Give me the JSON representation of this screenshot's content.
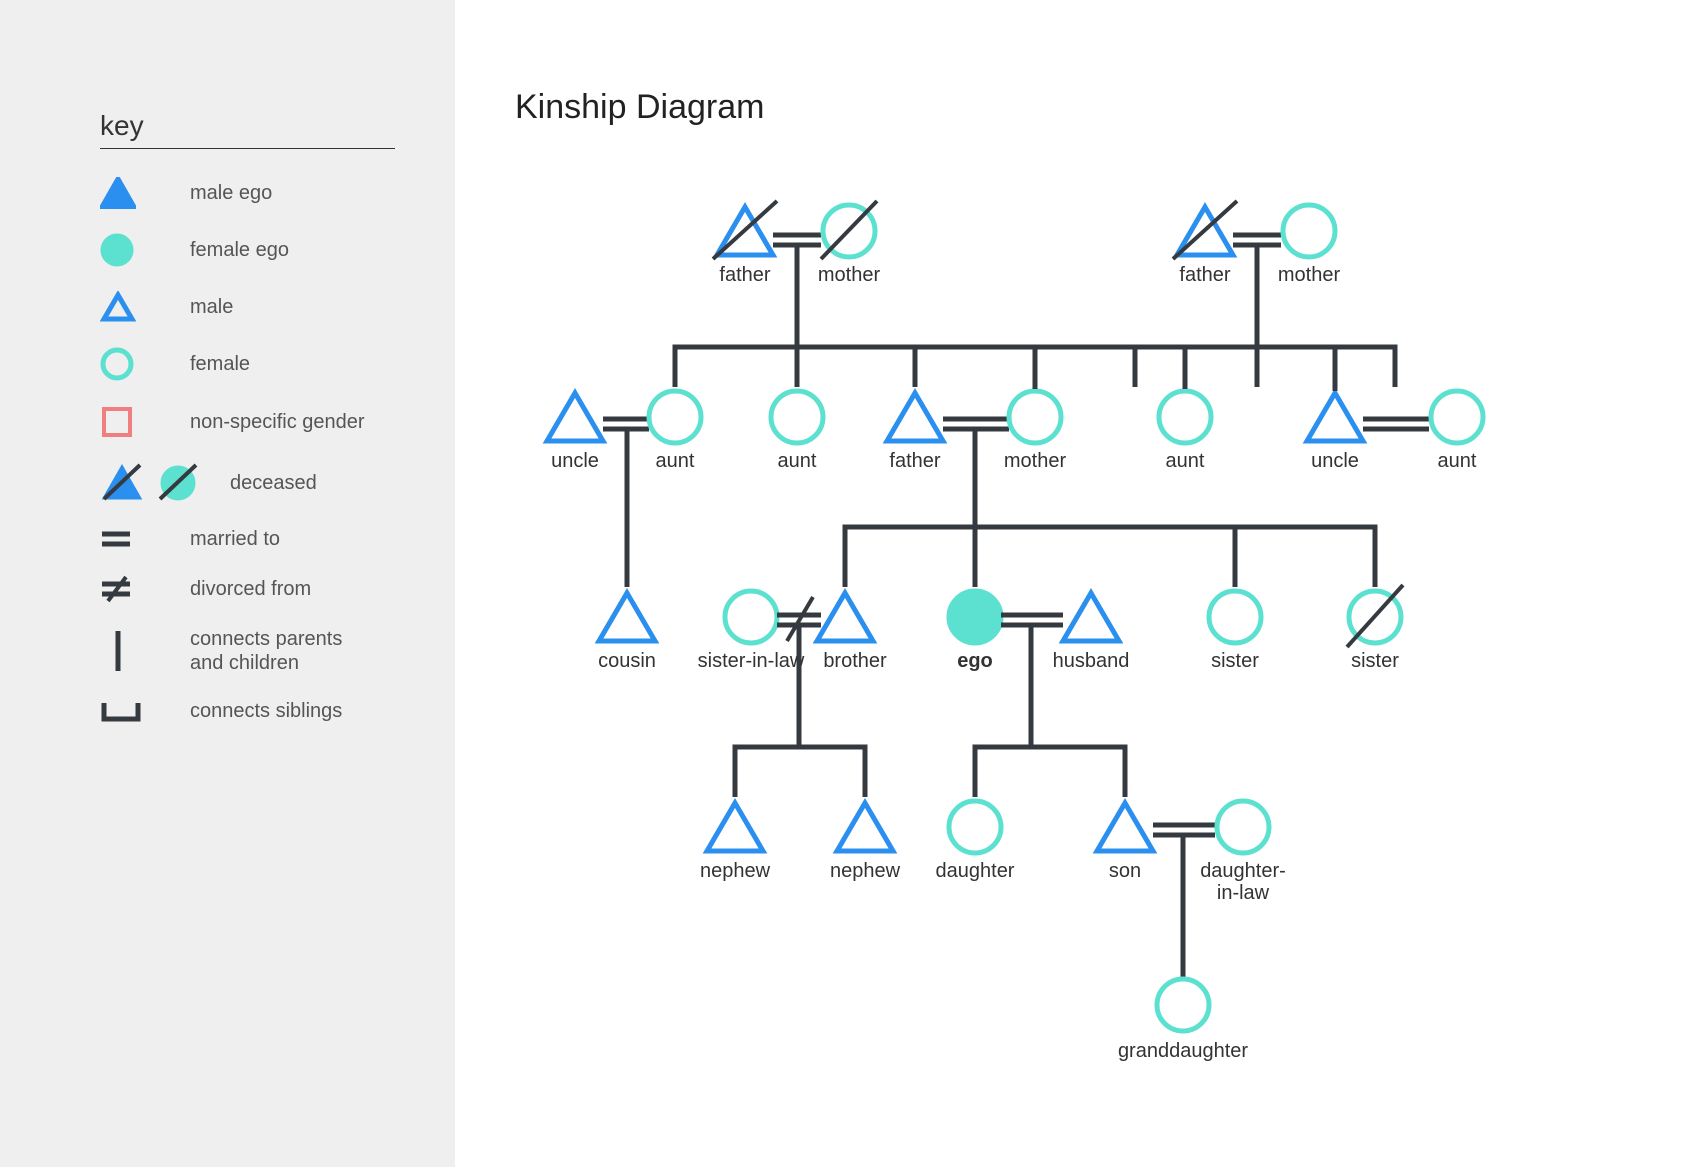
{
  "title": "Kinship Diagram",
  "key": {
    "heading": "key",
    "items": {
      "male_ego": "male ego",
      "female_ego": "female ego",
      "male": "male",
      "female": "female",
      "non_specific": "non-specific gender",
      "deceased": "deceased",
      "married": "married to",
      "divorced": "divorced from",
      "parents_children": "connects parents\nand children",
      "siblings": "connects siblings"
    }
  },
  "nodes": {
    "g1_fatherL": "father",
    "g1_motherL": "mother",
    "g1_fatherR": "father",
    "g1_motherR": "mother",
    "g2_uncleL": "uncle",
    "g2_auntL": "aunt",
    "g2_aunt2": "aunt",
    "g2_father": "father",
    "g2_mother": "mother",
    "g2_aunt3": "aunt",
    "g2_uncleR": "uncle",
    "g2_auntR": "aunt",
    "g3_cousin": "cousin",
    "g3_sil": "sister-in-law",
    "g3_brother": "brother",
    "g3_ego": "ego",
    "g3_husband": "husband",
    "g3_sister1": "sister",
    "g3_sister2": "sister",
    "g4_nephew1": "nephew",
    "g4_nephew2": "nephew",
    "g4_daughter": "daughter",
    "g4_son": "son",
    "g4_dil": "daughter-\nin-law",
    "g5_granddaughter": "granddaughter"
  },
  "colors": {
    "male": "#2b8fef",
    "female": "#5ce0cf",
    "nonspecific": "#f08080",
    "line": "#343a40"
  }
}
